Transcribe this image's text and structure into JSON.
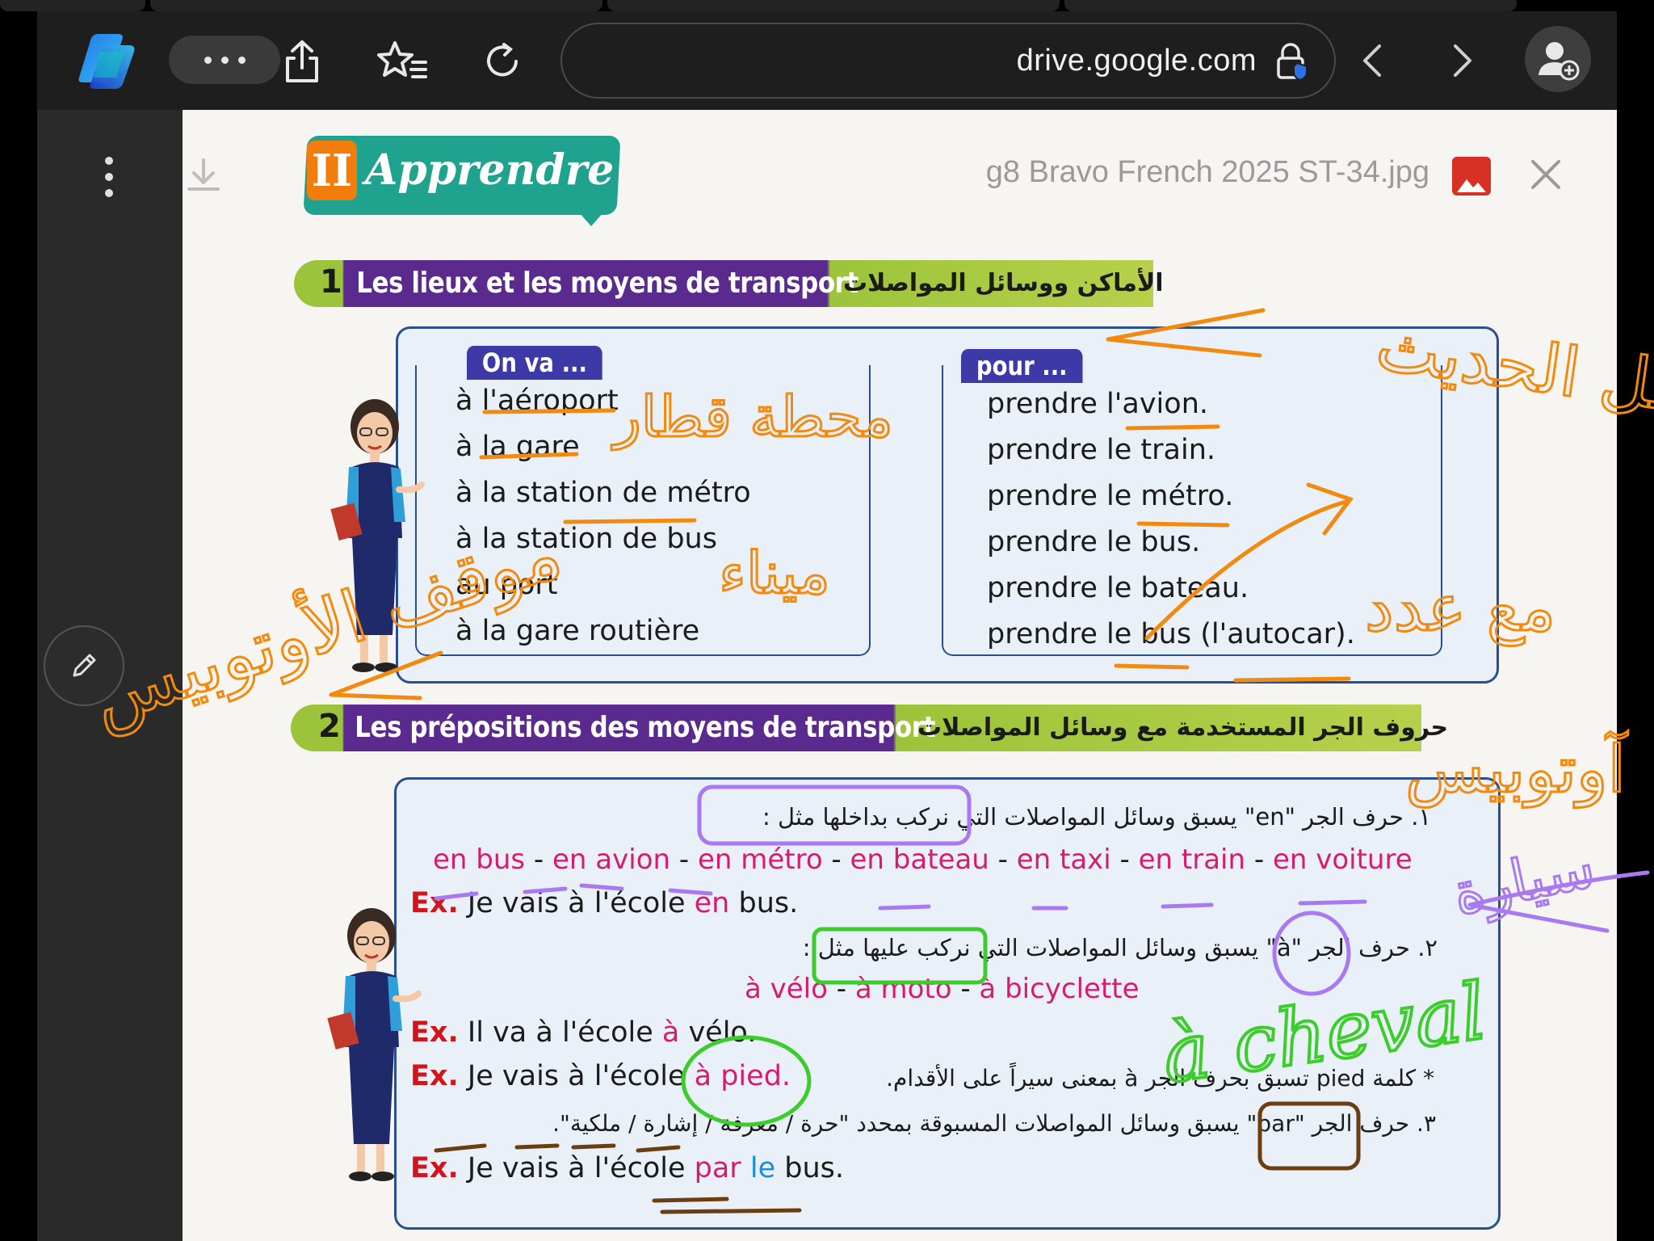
{
  "browser": {
    "url": "drive.google.com",
    "icons": [
      "copilot-logo",
      "more-icon",
      "share-icon",
      "favorites-icon",
      "refresh-icon",
      "lock-icon",
      "back-icon",
      "forward-icon",
      "profile-icon"
    ]
  },
  "viewer": {
    "file_name": "g8 Bravo French 2025 ST-34.jpg"
  },
  "document": {
    "header": {
      "number": "II",
      "title": "Apprendre"
    },
    "section1": {
      "number": "1",
      "title_fr": "Les lieux et les moyens de transport",
      "title_ar": "الأماكن ووسائل المواصلات",
      "left_tag": "On va ...",
      "left_lines": [
        "à l'aéroport",
        "à la gare",
        "à la station de métro",
        "à la station de bus",
        "au port",
        "à la gare routière"
      ],
      "right_tag": "pour ...",
      "right_lines": [
        "prendre l'avion.",
        "prendre le train.",
        "prendre le métro.",
        "prendre le bus.",
        "prendre le bateau.",
        "prendre le bus (l'autocar)."
      ]
    },
    "section2": {
      "number": "2",
      "title_fr": "Les prépositions des moyens de transport",
      "title_ar": "حروف الجر المستخدمة مع وسائل المواصلات",
      "rule1_ar": "١. حرف الجر \"en\" يسبق وسائل المواصلات التي نركب بداخلها مثل :",
      "rule1_list": [
        "en bus",
        "en avion",
        "en métro",
        "en bateau",
        "en taxi",
        "en train",
        "en voiture"
      ],
      "rule1_sep": " - ",
      "ex_label": "Ex.",
      "ex1_a": "Je vais à l'école ",
      "ex1_b": "en",
      "ex1_c": " bus.",
      "rule2_ar": "٢. حرف الجر \"à\" يسبق وسائل المواصلات التي نركب عليها مثل :",
      "rule2_list": [
        "à vélo",
        "à moto",
        "à bicyclette"
      ],
      "ex2_a": "Il va à l'école ",
      "ex2_b": "à",
      "ex2_c": " vélo.",
      "ex3_a": "Je vais à l'école ",
      "ex3_b": "à pied.",
      "note_ar": "* كلمة pied تسبق بحرف الجر à بمعنى سيراً على الأقدام.",
      "rule3_ar": "٣. حرف الجر \"par\" يسبق وسائل المواصلات المسبوقة بمحدد \"حرة / معرفة / إشارة / ملكية\".",
      "ex4_a": "Je vais à l'école ",
      "ex4_b": "par",
      "ex4_c": " ",
      "ex4_d": "le",
      "ex4_e": " bus."
    }
  },
  "annotations": {
    "ink_colors": {
      "orange": "#f28a0f",
      "purple": "#a879f0",
      "green": "#3ccc2c",
      "brown": "#6b3e12"
    },
    "notes": [
      {
        "text": "محطة قطار",
        "color": "orange"
      },
      {
        "text": "ميناء",
        "color": "orange"
      },
      {
        "text": "موقف الأوتوبيس",
        "color": "orange"
      },
      {
        "text": "داخل الحديث",
        "color": "orange"
      },
      {
        "text": "مع عدد",
        "color": "orange"
      },
      {
        "text": "آوتوبيس",
        "color": "orange"
      },
      {
        "text": "سيارة",
        "color": "purple"
      },
      {
        "text": "à cheval",
        "color": "green"
      }
    ]
  }
}
